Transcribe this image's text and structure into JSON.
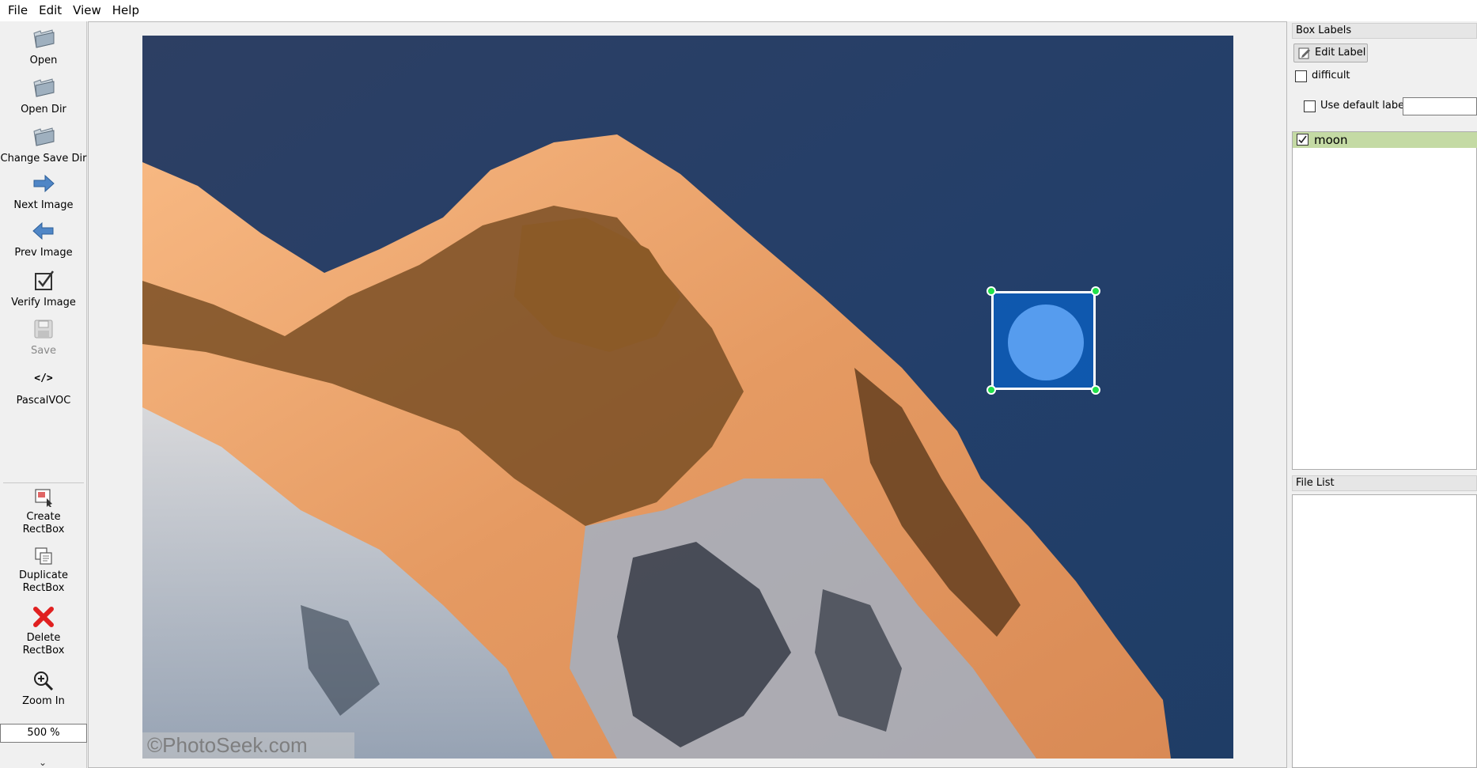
{
  "menu": [
    "File",
    "Edit",
    "View",
    "Help"
  ],
  "toolbar": {
    "open": "Open",
    "open_dir": "Open Dir",
    "change_save_dir": "Change Save Dir",
    "next_image": "Next Image",
    "prev_image": "Prev Image",
    "verify_image": "Verify Image",
    "save": "Save",
    "format_icon_text": "</>",
    "format": "PascalVOC",
    "create_rectbox_1": "Create",
    "create_rectbox_2": "RectBox",
    "duplicate_rectbox_1": "Duplicate",
    "duplicate_rectbox_2": "RectBox",
    "delete_rectbox_1": "Delete",
    "delete_rectbox_2": "RectBox",
    "zoom_in": "Zoom In",
    "zoom_value": "500 %",
    "more": "⌄"
  },
  "canvas": {
    "watermark": "©PhotoSeek.com",
    "annotation_color": "#006ee6",
    "handle_color": "#21e04a"
  },
  "dock": {
    "box_labels_title": "Box Labels",
    "edit_label": "Edit Label",
    "difficult": "difficult",
    "use_default_label": "Use default label",
    "default_label_value": "",
    "labels": [
      {
        "name": "moon",
        "checked": true,
        "highlight": "#c4daa4"
      }
    ],
    "file_list_title": "File List"
  }
}
